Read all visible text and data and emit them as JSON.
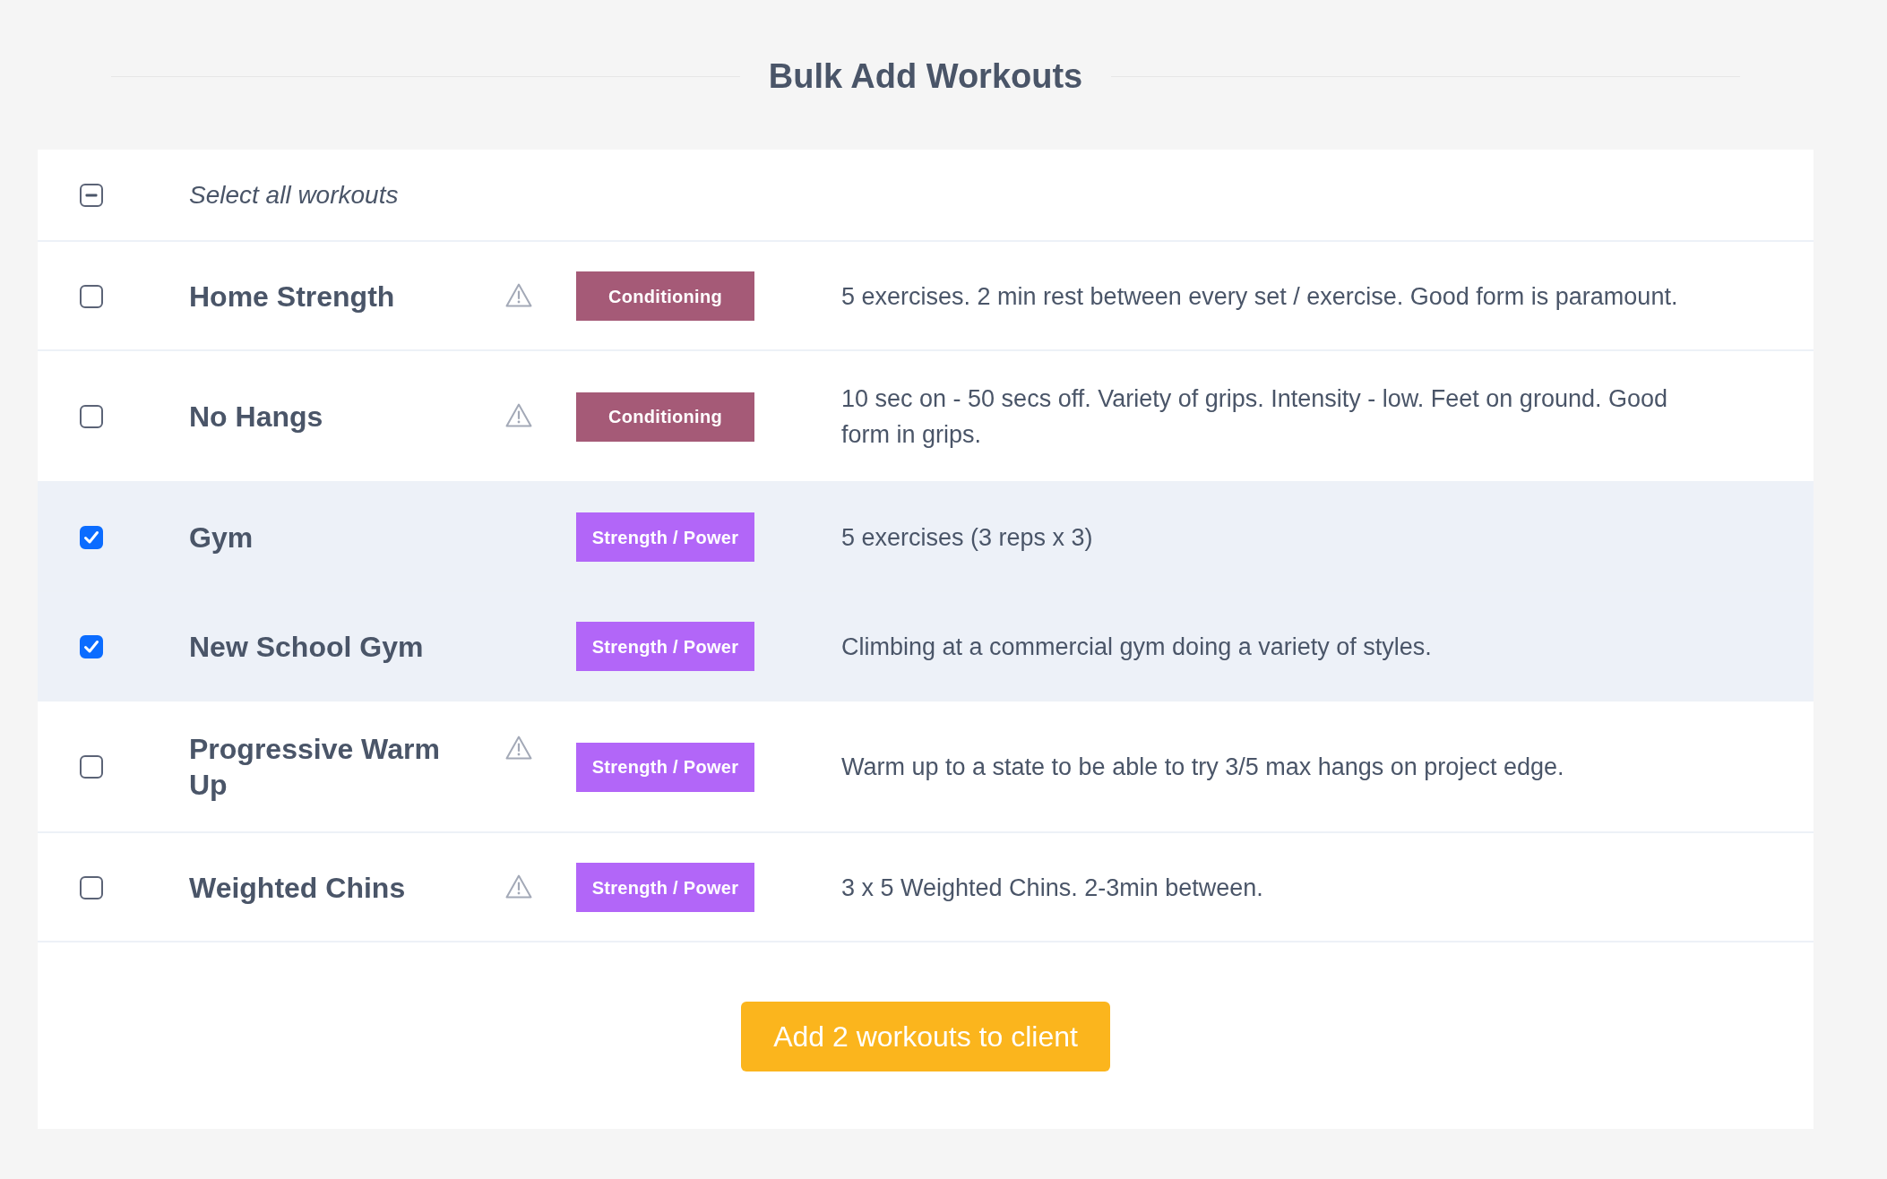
{
  "title": "Bulk Add Workouts",
  "select_all": {
    "label": "Select all workouts",
    "indeterminate": true
  },
  "workouts": [
    {
      "name": "Home Strength",
      "selected": false,
      "warning": true,
      "tag": {
        "label": "Conditioning",
        "color": "#a55a77"
      },
      "description": "5 exercises. 2 min rest between every set / exercise. Good form is paramount."
    },
    {
      "name": "No Hangs",
      "selected": false,
      "warning": true,
      "tag": {
        "label": "Conditioning",
        "color": "#a55a77"
      },
      "description": "10 sec on - 50 secs off. Variety of grips. Intensity - low. Feet on ground. Good form in grips."
    },
    {
      "name": "Gym",
      "selected": true,
      "warning": false,
      "tag": {
        "label": "Strength / Power",
        "color": "#b266f8"
      },
      "description": "5 exercises (3 reps x 3)"
    },
    {
      "name": "New School Gym",
      "selected": true,
      "warning": false,
      "tag": {
        "label": "Strength / Power",
        "color": "#b266f8"
      },
      "description": "Climbing at a commercial gym doing a variety of styles."
    },
    {
      "name": "Progressive Warm Up",
      "selected": false,
      "warning": true,
      "tag": {
        "label": "Strength / Power",
        "color": "#b266f8"
      },
      "description": "Warm up to a state to be able to try 3/5 max hangs on project edge."
    },
    {
      "name": "Weighted Chins",
      "selected": false,
      "warning": true,
      "tag": {
        "label": "Strength / Power",
        "color": "#b266f8"
      },
      "description": "3 x 5 Weighted Chins. 2-3min between."
    }
  ],
  "submit_button": "Add 2 workouts to client"
}
